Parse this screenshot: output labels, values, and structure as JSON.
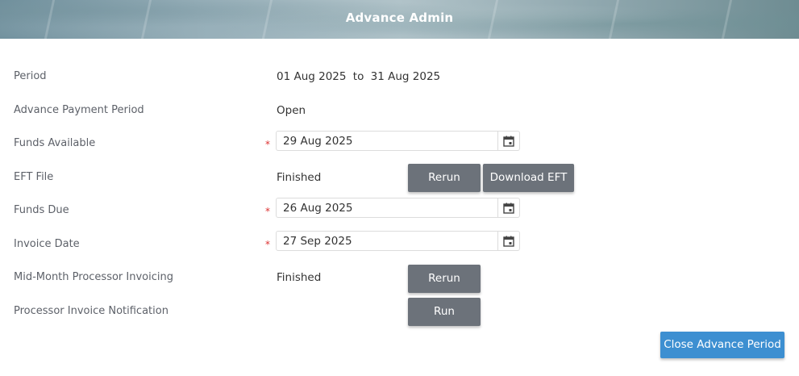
{
  "header": {
    "title": "Advance Admin"
  },
  "form": {
    "period": {
      "label": "Period",
      "start": "01 Aug 2025",
      "to": "to",
      "end": "31 Aug 2025"
    },
    "advance_payment_period": {
      "label": "Advance Payment Period",
      "value": "Open"
    },
    "funds_available": {
      "label": "Funds Available",
      "required": "*",
      "value": "29 Aug 2025"
    },
    "eft_file": {
      "label": "EFT File",
      "status": "Finished",
      "rerun_label": "Rerun",
      "download_label": "Download EFT"
    },
    "funds_due": {
      "label": "Funds Due",
      "required": "*",
      "value": "26 Aug 2025"
    },
    "invoice_date": {
      "label": "Invoice Date",
      "required": "*",
      "value": "27 Sep 2025"
    },
    "mid_month_invoicing": {
      "label": "Mid-Month Processor Invoicing",
      "status": "Finished",
      "rerun_label": "Rerun"
    },
    "processor_invoice_notification": {
      "label": "Processor Invoice Notification",
      "run_label": "Run"
    }
  },
  "actions": {
    "close_label": "Close Advance Period"
  },
  "icons": {
    "calendar": "calendar-icon"
  },
  "colors": {
    "secondary_button": "#6c727a",
    "primary_button": "#3d8fd1",
    "required": "#dd3333"
  }
}
